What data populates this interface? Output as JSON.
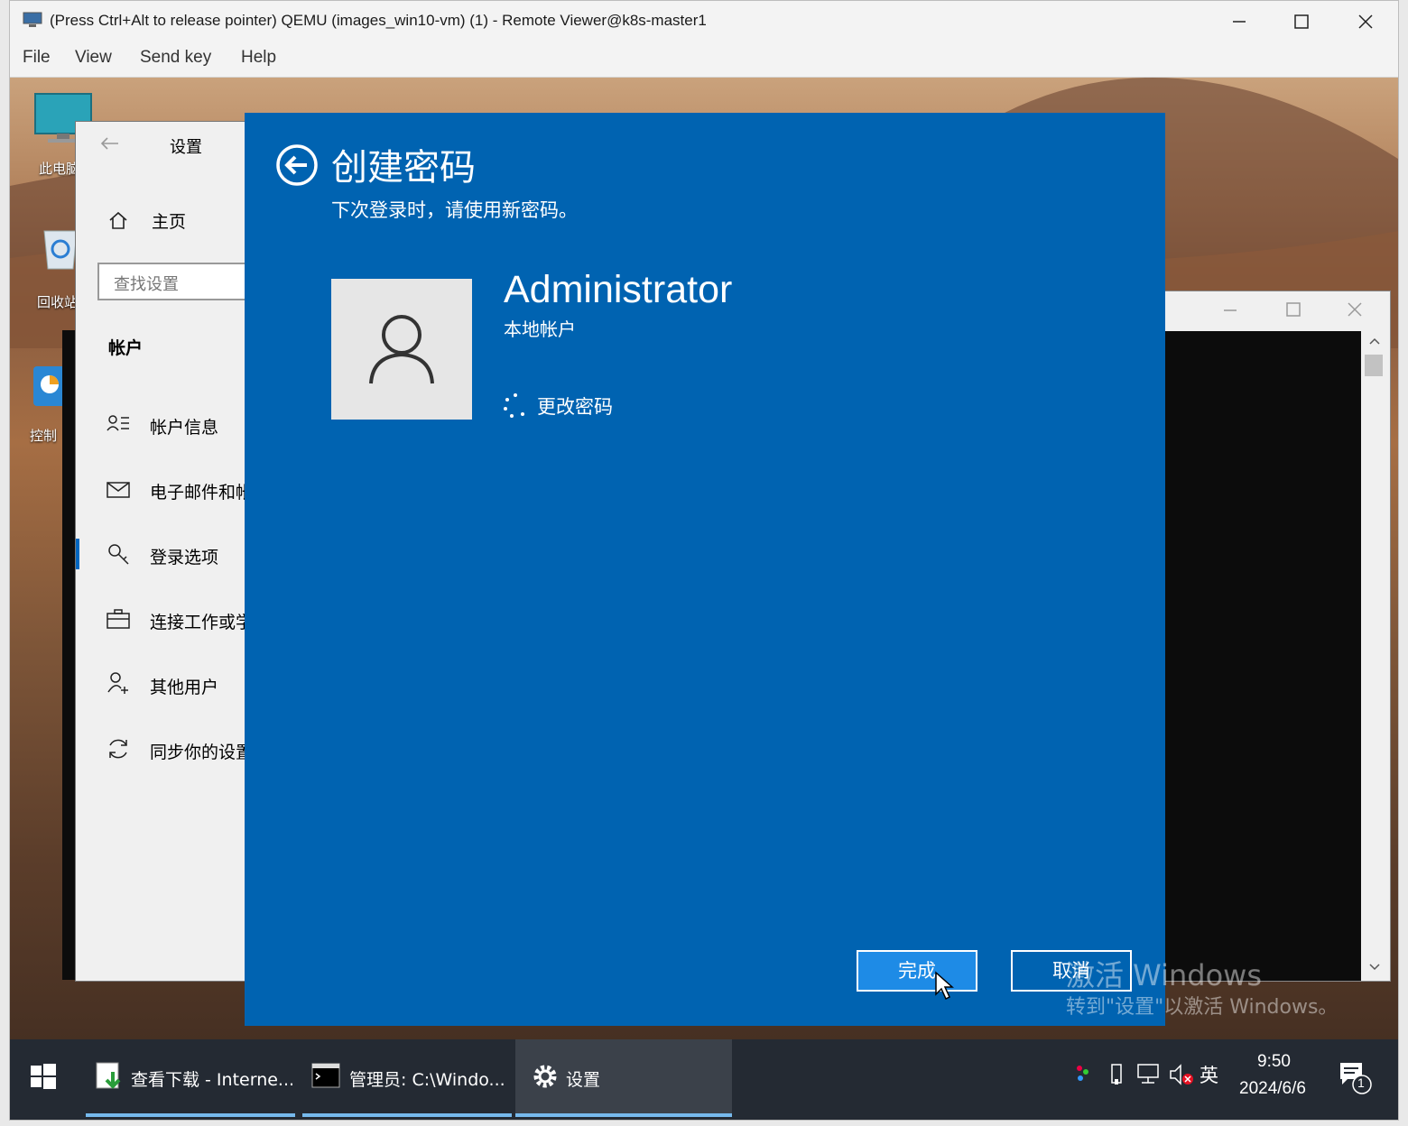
{
  "viewer": {
    "title": "(Press Ctrl+Alt to release pointer) QEMU (images_win10-vm) (1) - Remote Viewer@k8s-master1",
    "menu": [
      "File",
      "View",
      "Send key",
      "Help"
    ]
  },
  "desktop": {
    "icons": [
      {
        "label": "此电脑",
        "icon": "computer-icon"
      },
      {
        "label": "回收站",
        "icon": "recycle-bin-icon"
      },
      {
        "label": "控制",
        "icon": "control-panel-icon"
      }
    ]
  },
  "settings": {
    "title": "设置",
    "home": "主页",
    "search_placeholder": "查找设置",
    "section": "帐户",
    "nav": [
      {
        "label": "帐户信息",
        "icon": "account-info-icon"
      },
      {
        "label": "电子邮件和帐",
        "icon": "mail-icon"
      },
      {
        "label": "登录选项",
        "icon": "key-icon"
      },
      {
        "label": "连接工作或学",
        "icon": "briefcase-icon"
      },
      {
        "label": "其他用户",
        "icon": "add-user-icon"
      },
      {
        "label": "同步你的设置",
        "icon": "sync-icon"
      }
    ]
  },
  "dialog": {
    "title": "创建密码",
    "subtitle": "下次登录时，请使用新密码。",
    "user_name": "Administrator",
    "account_type": "本地帐户",
    "status": "更改密码",
    "finish_label": "完成",
    "cancel_label": "取消"
  },
  "watermark": {
    "line1": "激活 Windows",
    "line2": "转到\"设置\"以激活 Windows。"
  },
  "taskbar": {
    "tasks": [
      {
        "label": "查看下载 - Interne...",
        "icon": "download-icon"
      },
      {
        "label": "管理员: C:\\Windo...",
        "icon": "cmd-icon"
      },
      {
        "label": "设置",
        "icon": "gear-icon"
      }
    ],
    "ime": "英",
    "time": "9:50",
    "date": "2024/6/6",
    "notification_count": "1"
  },
  "colors": {
    "dialog_bg": "#0063b1",
    "finish_bg": "#1e8be6",
    "taskbar_bg": "#242a33",
    "accent": "#0067c0"
  }
}
